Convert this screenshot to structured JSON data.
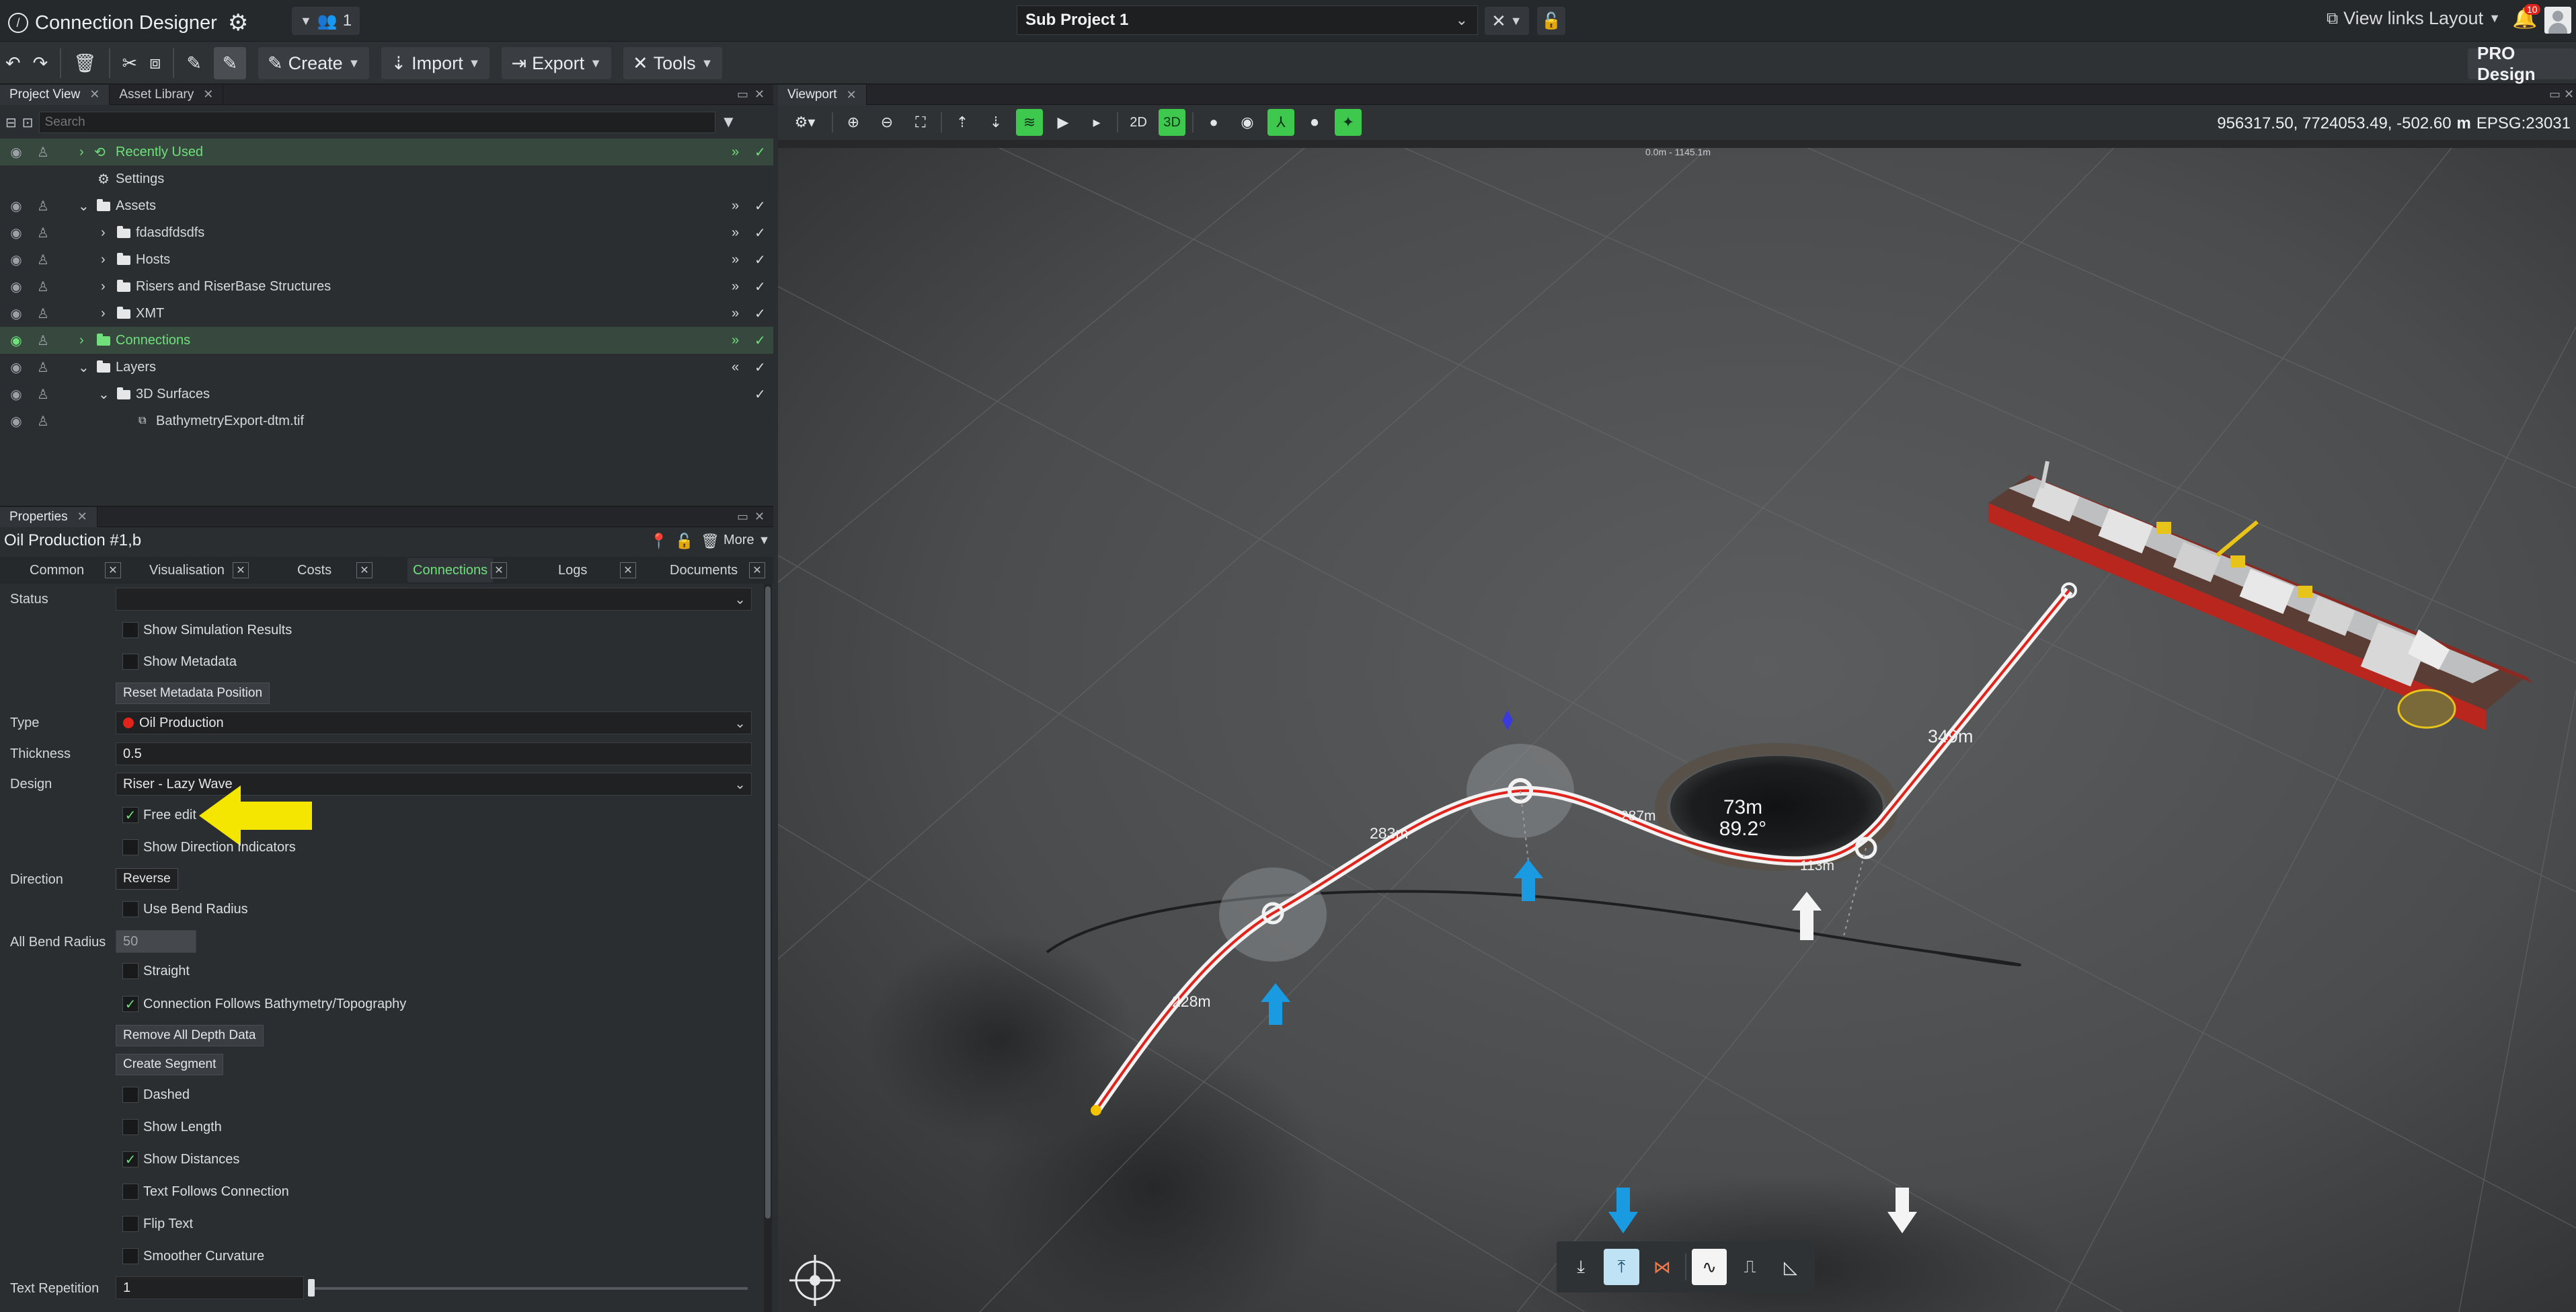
{
  "titlebar": {
    "app_title": "Connection Designer",
    "users_count": "1",
    "project_name": "Sub Project 1",
    "view_links": "View links",
    "layout": "Layout",
    "notifications": "10"
  },
  "toolbar": {
    "create": "Create",
    "import": "Import",
    "export": "Export",
    "tools": "Tools",
    "pro_design": "PRO Design"
  },
  "project_panel": {
    "tab_project": "Project View",
    "tab_assets": "Asset Library",
    "search_placeholder": "Search",
    "tree": [
      {
        "label": "Recently Used"
      },
      {
        "label": "Settings"
      },
      {
        "label": "Assets"
      },
      {
        "label": "fdasdfdsdfs"
      },
      {
        "label": "Hosts"
      },
      {
        "label": "Risers and RiserBase Structures"
      },
      {
        "label": "XMT"
      },
      {
        "label": "Connections"
      },
      {
        "label": "Layers"
      },
      {
        "label": "3D Surfaces"
      },
      {
        "label": "BathymetryExport-dtm.tif"
      }
    ]
  },
  "properties": {
    "panel_title": "Properties",
    "object_name": "Oil Production #1,b",
    "more": "More",
    "tabs": [
      "Common",
      "Visualisation",
      "Costs",
      "Connections",
      "Logs",
      "Documents"
    ],
    "status_label": "Status",
    "show_simulation_results": "Show Simulation Results",
    "show_metadata": "Show Metadata",
    "reset_metadata_position": "Reset Metadata Position",
    "type_label": "Type",
    "type_value": "Oil Production",
    "thickness_label": "Thickness",
    "thickness_value": "0.5",
    "design_label": "Design",
    "design_value": "Riser - Lazy Wave",
    "free_edit": "Free edit",
    "show_direction_indicators": "Show Direction Indicators",
    "direction_label": "Direction",
    "reverse": "Reverse",
    "use_bend_radius": "Use Bend Radius",
    "all_bend_radius_label": "All Bend Radius",
    "all_bend_radius_value": "50",
    "straight": "Straight",
    "follows_bathymetry": "Connection Follows Bathymetry/Topography",
    "remove_depth": "Remove All Depth Data",
    "create_segment": "Create Segment",
    "dashed": "Dashed",
    "show_length": "Show Length",
    "show_distances": "Show Distances",
    "text_follows": "Text Follows Connection",
    "flip_text": "Flip Text",
    "smoother_curvature": "Smoother Curvature",
    "text_repetition_label": "Text Repetition",
    "text_repetition_value": "1",
    "checked": {
      "free_edit": true,
      "follows_bathymetry": true,
      "show_distances": true
    }
  },
  "viewport": {
    "tab": "Viewport",
    "mode_2d": "2D",
    "mode_3d": "3D",
    "coords_value": "956317.50, 7724053.49, -502.60",
    "coords_unit": "m",
    "coords_epsg": "EPSG:23031",
    "scale_label": "0.0m - 1145.1m",
    "labels": {
      "seg1": "228m",
      "seg2": "283m",
      "seg3": "287m",
      "seg4": "113m",
      "seg5": "349m",
      "bend_length": "73m",
      "bend_angle": "89.2°"
    }
  },
  "colors": {
    "accent_green": "#3fc84e",
    "highlight_yellow": "#f5e600",
    "arrow_blue": "#1a9ae0",
    "oil_red": "#e0241b"
  }
}
